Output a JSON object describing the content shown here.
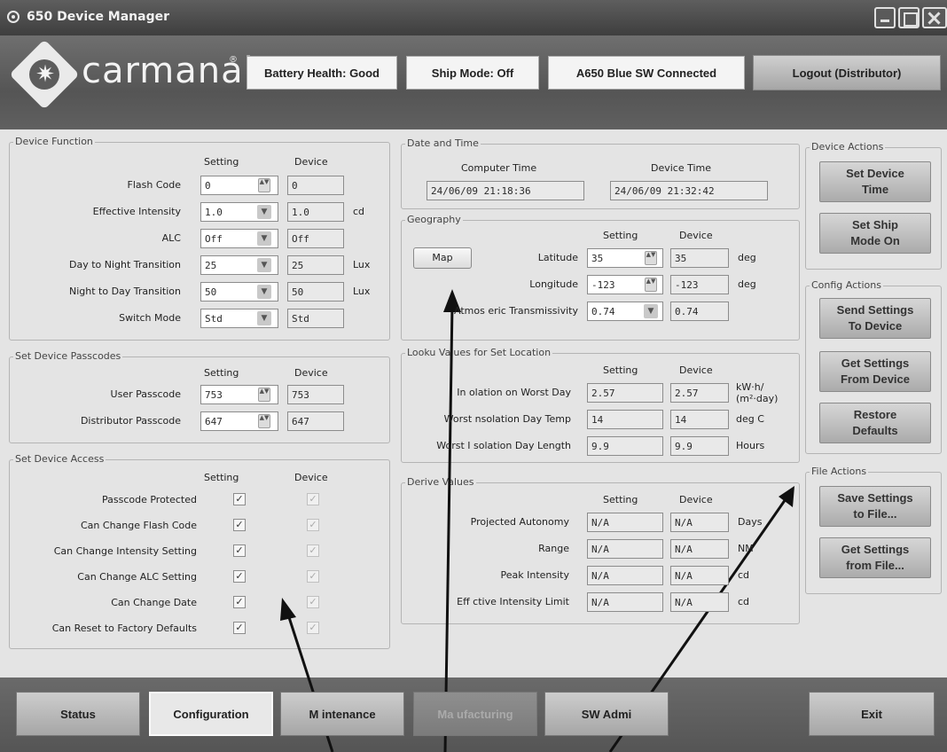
{
  "window": {
    "title": "650 Device Manager"
  },
  "header": {
    "brand": "carmanah",
    "brand_reg": "®",
    "battery": "Battery Health: Good",
    "ship_mode": "Ship Mode: Off",
    "connection": "A650 Blue SW Connected",
    "logout": "Logout (Distributor)"
  },
  "device_function": {
    "title": "Device Function",
    "col_setting": "Setting",
    "col_device": "Device",
    "rows": [
      {
        "label": "Flash Code",
        "setting": "0",
        "device": "0",
        "unit": "",
        "control": "spin"
      },
      {
        "label": "Effective Intensity",
        "setting": "1.0",
        "device": "1.0",
        "unit": "cd",
        "control": "dropdown"
      },
      {
        "label": "ALC",
        "setting": "Off",
        "device": "Off",
        "unit": "",
        "control": "dropdown"
      },
      {
        "label": "Day to Night Transition",
        "setting": "25",
        "device": "25",
        "unit": "Lux",
        "control": "dropdown"
      },
      {
        "label": "Night to Day Transition",
        "setting": "50",
        "device": "50",
        "unit": "Lux",
        "control": "dropdown"
      },
      {
        "label": "Switch Mode",
        "setting": "Std",
        "device": "Std",
        "unit": "",
        "control": "dropdown"
      }
    ]
  },
  "passcodes": {
    "title": "Set Device Passcodes",
    "col_setting": "Setting",
    "col_device": "Device",
    "rows": [
      {
        "label": "User Passcode",
        "setting": "753",
        "device": "753"
      },
      {
        "label": "Distributor Passcode",
        "setting": "647",
        "device": "647"
      }
    ]
  },
  "access": {
    "title": "Set Device Access",
    "col_setting": "Setting",
    "col_device": "Device",
    "rows": [
      {
        "label": "Passcode Protected",
        "setting": true,
        "device": true
      },
      {
        "label": "Can Change Flash Code",
        "setting": true,
        "device": true
      },
      {
        "label": "Can Change Intensity Setting",
        "setting": true,
        "device": true
      },
      {
        "label": "Can Change ALC Setting",
        "setting": true,
        "device": true
      },
      {
        "label": "Can Change Date",
        "setting": true,
        "device": true
      },
      {
        "label": "Can Reset to Factory Defaults",
        "setting": true,
        "device": true
      }
    ]
  },
  "datetime": {
    "title": "Date and Time",
    "computer_label": "Computer Time",
    "device_label": "Device Time",
    "computer_value": "24/06/09 21:18:36",
    "device_value": "24/06/09 21:32:42"
  },
  "geography": {
    "title": "Geography",
    "col_setting": "Setting",
    "col_device": "Device",
    "map_button": "Map",
    "rows": [
      {
        "label": "Latitude",
        "setting": "35",
        "device": "35",
        "unit": "deg",
        "control": "spin"
      },
      {
        "label": "Longitude",
        "setting": "-123",
        "device": "-123",
        "unit": "deg",
        "control": "spin"
      },
      {
        "label": "Atmos  eric Transmissivity",
        "setting": "0.74",
        "device": "0.74",
        "unit": "",
        "control": "dropdown"
      }
    ]
  },
  "lookup": {
    "title": "Looku  Values for Set Location",
    "col_setting": "Setting",
    "col_device": "Device",
    "rows": [
      {
        "label": "In  olation on Worst Day",
        "setting": "2.57",
        "device": "2.57",
        "unit": "kW·h/\n(m²·day)"
      },
      {
        "label": "Worst  nsolation Day Temp",
        "setting": "14",
        "device": "14",
        "unit": "deg C"
      },
      {
        "label": "Worst I  solation Day Length",
        "setting": "9.9",
        "device": "9.9",
        "unit": "Hours"
      }
    ]
  },
  "derived": {
    "title": "Derive  Values",
    "col_setting": "Setting",
    "col_device": "Device",
    "rows": [
      {
        "label": "Projected Autonomy",
        "setting": "N/A",
        "device": "N/A",
        "unit": "Days"
      },
      {
        "label": "Range",
        "setting": "N/A",
        "device": "N/A",
        "unit": "NM"
      },
      {
        "label": "Peak Intensity",
        "setting": "N/A",
        "device": "N/A",
        "unit": "cd"
      },
      {
        "label": "Eff  ctive Intensity Limit",
        "setting": "N/A",
        "device": "N/A",
        "unit": "cd"
      }
    ]
  },
  "device_actions": {
    "title": "Device Actions",
    "buttons": [
      "Set Device\nTime",
      "Set Ship\nMode On"
    ]
  },
  "config_actions": {
    "title": "Config Actions",
    "buttons": [
      "Send Settings\nTo Device",
      "Get Settings\nFrom Device",
      "Restore\nDefaults"
    ]
  },
  "file_actions": {
    "title": "File Actions",
    "buttons": [
      "Save Settings\nto File...",
      "Get Settings\nfrom File..."
    ]
  },
  "footer": {
    "tabs": [
      {
        "label": "Status",
        "state": "normal"
      },
      {
        "label": "Configuration",
        "state": "active"
      },
      {
        "label": "M  intenance",
        "state": "normal"
      },
      {
        "label": "Ma  ufacturing",
        "state": "disabled"
      },
      {
        "label": "SW Admi",
        "state": "normal"
      }
    ],
    "exit": "Exit"
  }
}
